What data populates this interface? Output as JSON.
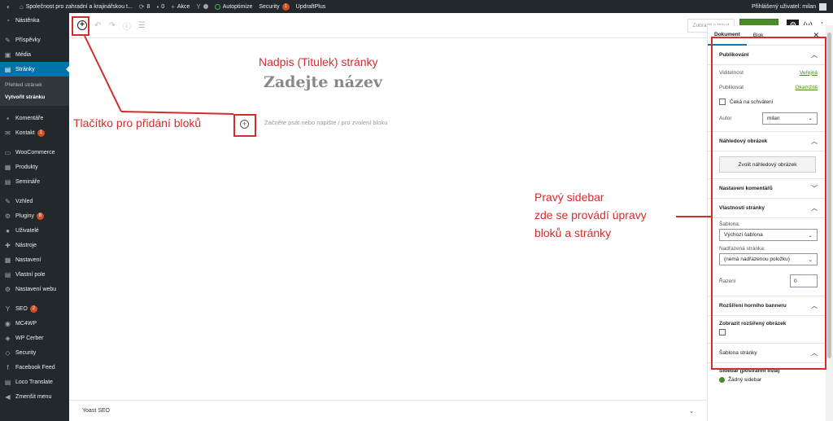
{
  "adminbar": {
    "site_title": "Společnost pro zahradní a krajinářskou t...",
    "updates_count": "8",
    "comments_count": "0",
    "new_label": "Akce",
    "autoptimize": "Autoptimize",
    "security": "Security",
    "security_badge": "1",
    "updraft": "UpdraftPlus",
    "user_greeting": "Přihlášený uživatel: milan"
  },
  "sidebar": {
    "dashboard": "Nástěnka",
    "posts": "Příspěvky",
    "media": "Média",
    "pages": "Stránky",
    "sub_overview": "Přehled stránek",
    "sub_create": "Vytvořit stránku",
    "comments": "Komentáře",
    "contact": "Kontakt",
    "contact_badge": "1",
    "woocommerce": "WooCommerce",
    "products": "Produkty",
    "seminars": "Semináře",
    "appearance": "Vzhled",
    "plugins": "Pluginy",
    "plugins_badge": "8",
    "users": "Uživatelé",
    "tools": "Nástroje",
    "settings": "Nastavení",
    "custom_fields": "Vlastní pole",
    "web_settings": "Nastavení webu",
    "seo": "SEO",
    "seo_badge": "2",
    "mc4wp": "MC4WP",
    "wp_cerber": "WP Cerber",
    "security": "Security",
    "facebook_feed": "Facebook Feed",
    "loco_translate": "Loco Translate",
    "collapse": "Zmenšit menu"
  },
  "toolbar": {
    "preview": "Zobrazit náhled",
    "publish": "Publikovat"
  },
  "editor": {
    "title_placeholder": "Zadejte název",
    "block_placeholder": "Začněte psát nebo napište / pro zvolení bloku",
    "yoast_panel": "Yoast SEO"
  },
  "right_sidebar": {
    "tab_document": "Dokument",
    "tab_block": "Blok",
    "publish_title": "Publikování",
    "visibility_label": "Viditelnost",
    "visibility_value": "Veřejná",
    "publish_label": "Publikovat",
    "publish_value": "Okamžitě",
    "pending_label": "Čeká na schválení",
    "author_label": "Autor",
    "author_value": "milan",
    "featured_title": "Náhledový obrázek",
    "featured_button": "Zvolit náhledový obrázek",
    "comments_title": "Nastavení komentářů",
    "attributes_title": "Vlastnosti stránky",
    "template_label": "Šablona:",
    "template_value": "Výchozí šablona",
    "parent_label": "Nadřazená stránka:",
    "parent_value": "(nemá nadřazenou položku)",
    "order_label": "Řazení",
    "order_value": "0",
    "banner_title": "Rozšíření horního banneru",
    "banner_show": "Zobrazit rozšířený obrázek",
    "page_template_title": "Šablona stránky",
    "sidebar_label": "Sidebar (postranní lišta)",
    "no_sidebar": "Žádný sidebar"
  },
  "annotations": {
    "title_note": "Nadpis (Titulek) stránky",
    "add_block_note": "Tlačítko pro přidání bloků",
    "sidebar_note_1": "Pravý sidebar",
    "sidebar_note_2": "zde se provádí úpravy",
    "sidebar_note_3": "bloků a stránky",
    "color": "#d32d2d"
  }
}
